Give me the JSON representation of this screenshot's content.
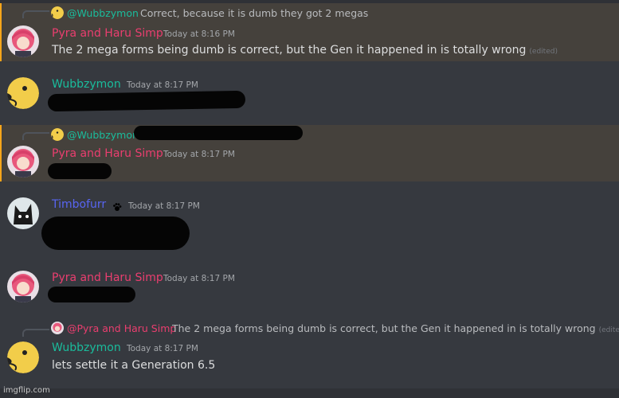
{
  "messages": [
    {
      "reply": {
        "author": "@Wubbzymon",
        "text": "Correct, because it is dumb they got 2 megas"
      },
      "author": "Pyra and Haru Simp",
      "time": "Today at 8:16 PM",
      "content": "The 2 mega forms being dumb is correct, but the Gen it happened in is totally wrong",
      "edited": "(edited)"
    },
    {
      "author": "Wubbzymon",
      "time": "Today at 8:17 PM"
    },
    {
      "reply": {
        "author": "@Wubbzymon"
      },
      "author": "Pyra and Haru Simp",
      "time": "Today at 8:17 PM"
    },
    {
      "author": "Timbofurr",
      "time": "Today at 8:17 PM",
      "badge_icon": "paw-icon"
    },
    {
      "author": "Pyra and Haru Simp",
      "time": "Today at 8:17 PM"
    },
    {
      "reply": {
        "author": "@Pyra and Haru Simp",
        "text": "The 2 mega forms being dumb is correct, but the Gen it happened in is totally wrong",
        "edited": "(edited)"
      },
      "author": "Wubbzymon",
      "time": "Today at 8:17 PM",
      "content": "lets settle it a Generation 6.5"
    }
  ],
  "watermark": "imgflip.com",
  "colors": {
    "background": "#36393f",
    "mention_highlight": "#45413c",
    "name_pink": "#ea3e6f",
    "name_teal": "#1abc9c",
    "name_blue": "#5865f2"
  }
}
